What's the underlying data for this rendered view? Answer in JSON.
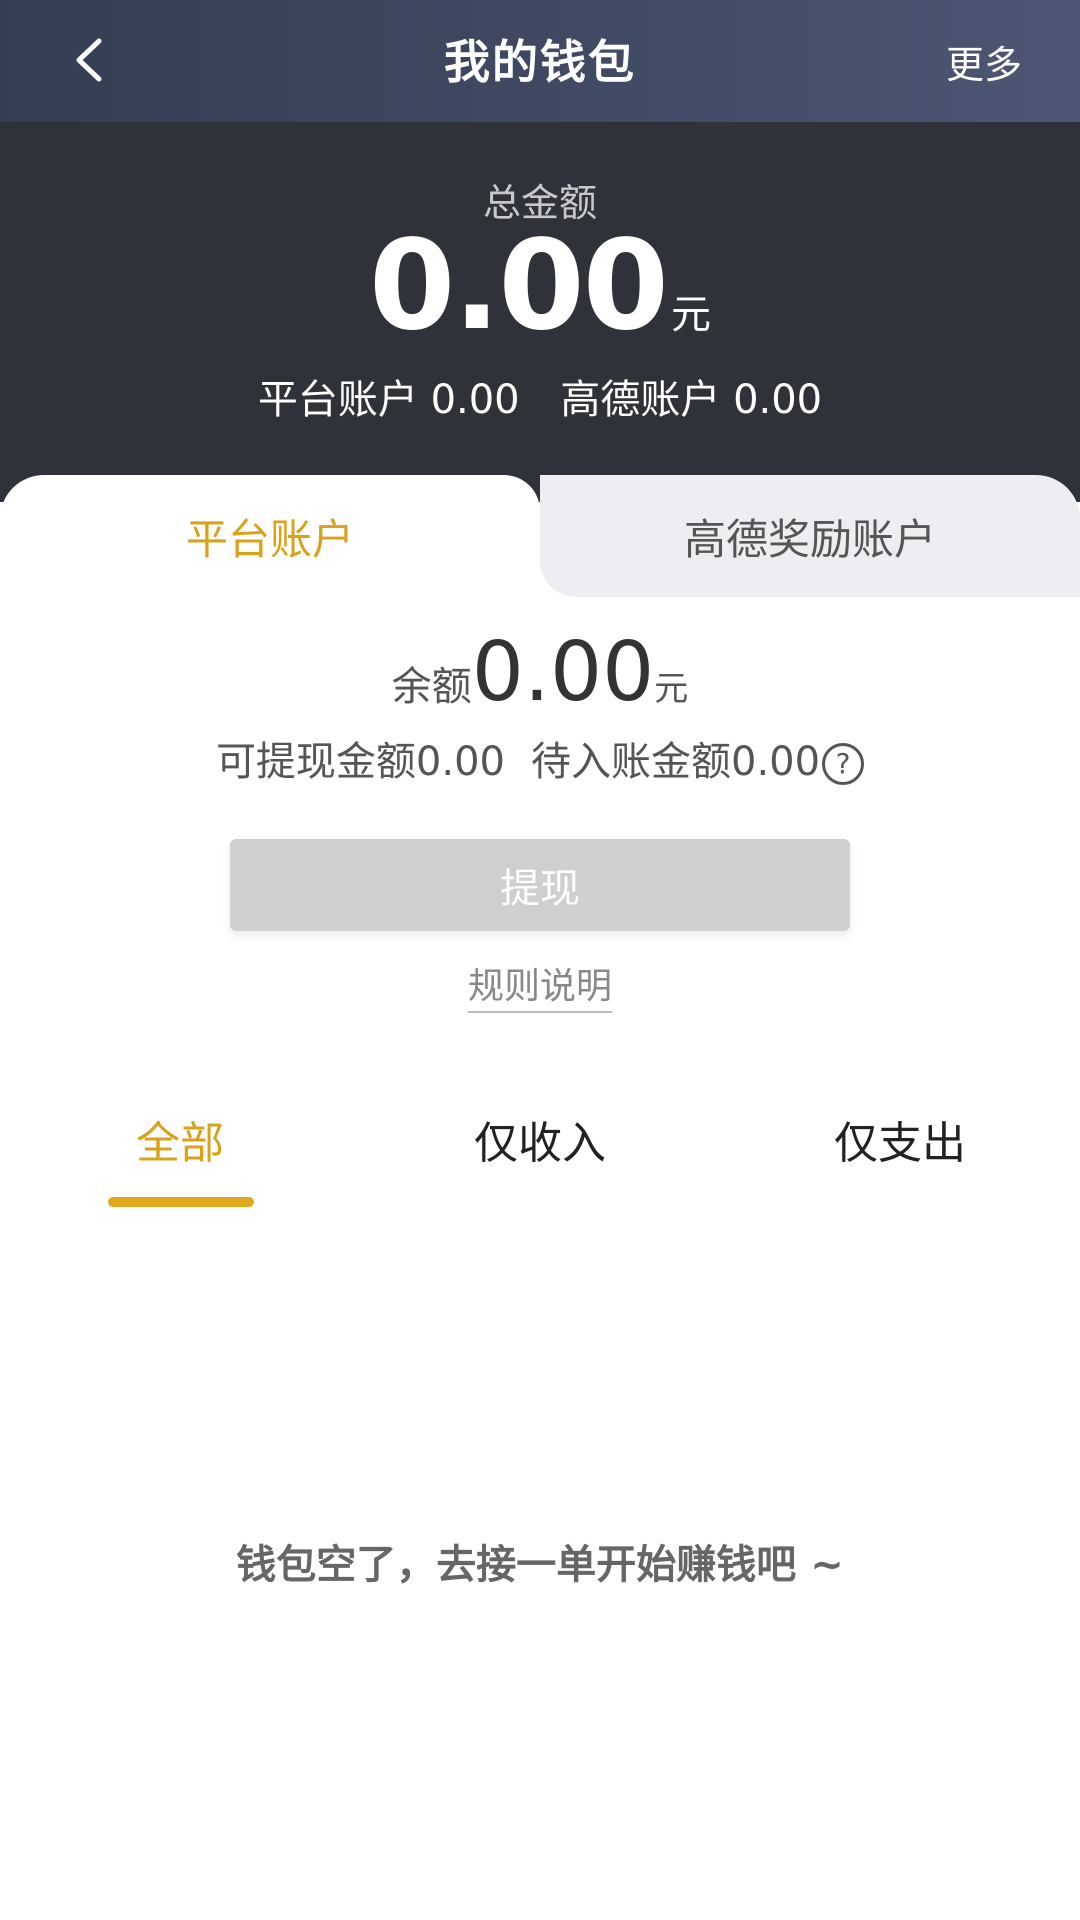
{
  "header": {
    "title": "我的钱包",
    "more_label": "更多"
  },
  "summary": {
    "total_label": "总金额",
    "total_amount": "0.00",
    "total_unit": "元",
    "platform_account_text": "平台账户 0.00",
    "gaode_account_text": "高德账户 0.00"
  },
  "account_tabs": {
    "active_label": "平台账户",
    "inactive_label": "高德奖励账户"
  },
  "balance": {
    "label": "余额",
    "amount": "0.00",
    "unit": "元",
    "withdrawable_text": "可提现金额0.00",
    "pending_text": "待入账金额0.00",
    "help_glyph": "?"
  },
  "actions": {
    "withdraw_label": "提现",
    "rules_label": "规则说明"
  },
  "filters": {
    "all": "全部",
    "income": "仅收入",
    "expense": "仅支出"
  },
  "empty_state": {
    "message": "钱包空了，去接一单开始赚钱吧 ~"
  },
  "colors": {
    "accent": "#d9a21b",
    "header_bg": "#30323a",
    "button_disabled": "#cfcfd2"
  },
  "icons": {
    "back": "chevron-left-icon",
    "help": "question-circle-icon"
  }
}
